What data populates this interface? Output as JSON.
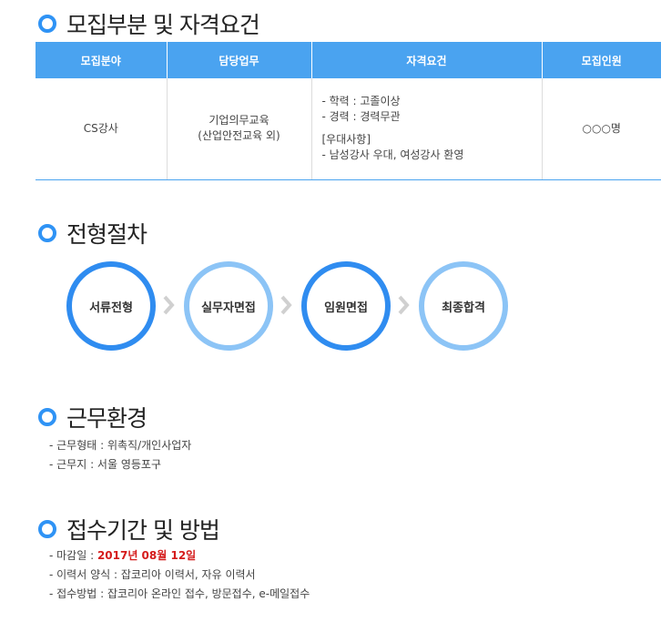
{
  "sections": {
    "recruit": "모집부분 및 자격요건",
    "process": "전형절차",
    "environment": "근무환경",
    "apply": "접수기간 및 방법"
  },
  "table": {
    "headers": [
      "모집분야",
      "담당업무",
      "자격요건",
      "모집인원"
    ],
    "row": {
      "field": "CS강사",
      "duty_line1": "기업의무교육",
      "duty_line2": "(산업안전교육 외)",
      "qual": [
        "- 학력 : 고졸이상",
        "- 경력 : 경력무관"
      ],
      "pref_title": "[우대사항]",
      "pref": "- 남성강사 우대, 여성강사 환영",
      "count": "○○○명"
    }
  },
  "steps": [
    "서류전형",
    "실무자면접",
    "임원면접",
    "최종합격"
  ],
  "environment": [
    "- 근무형태 : 위촉직/개인사업자",
    "- 근무지 : 서울 영등포구"
  ],
  "apply": {
    "deadline_label": "- 마감일 : ",
    "deadline_value": "2017년 08월 12일",
    "resume": "- 이력서 양식 : 잡코리아 이력서, 자유 이력서",
    "method": "- 접수방법 : 잡코리아 온라인 접수, 방문접수, e-메일접수"
  },
  "colors": {
    "accent": "#2f93f5",
    "header_bg": "#4aa3f0",
    "step_dark": "#2f8cf0",
    "step_light": "#8cc4f6",
    "deadline": "#d51b1b"
  }
}
